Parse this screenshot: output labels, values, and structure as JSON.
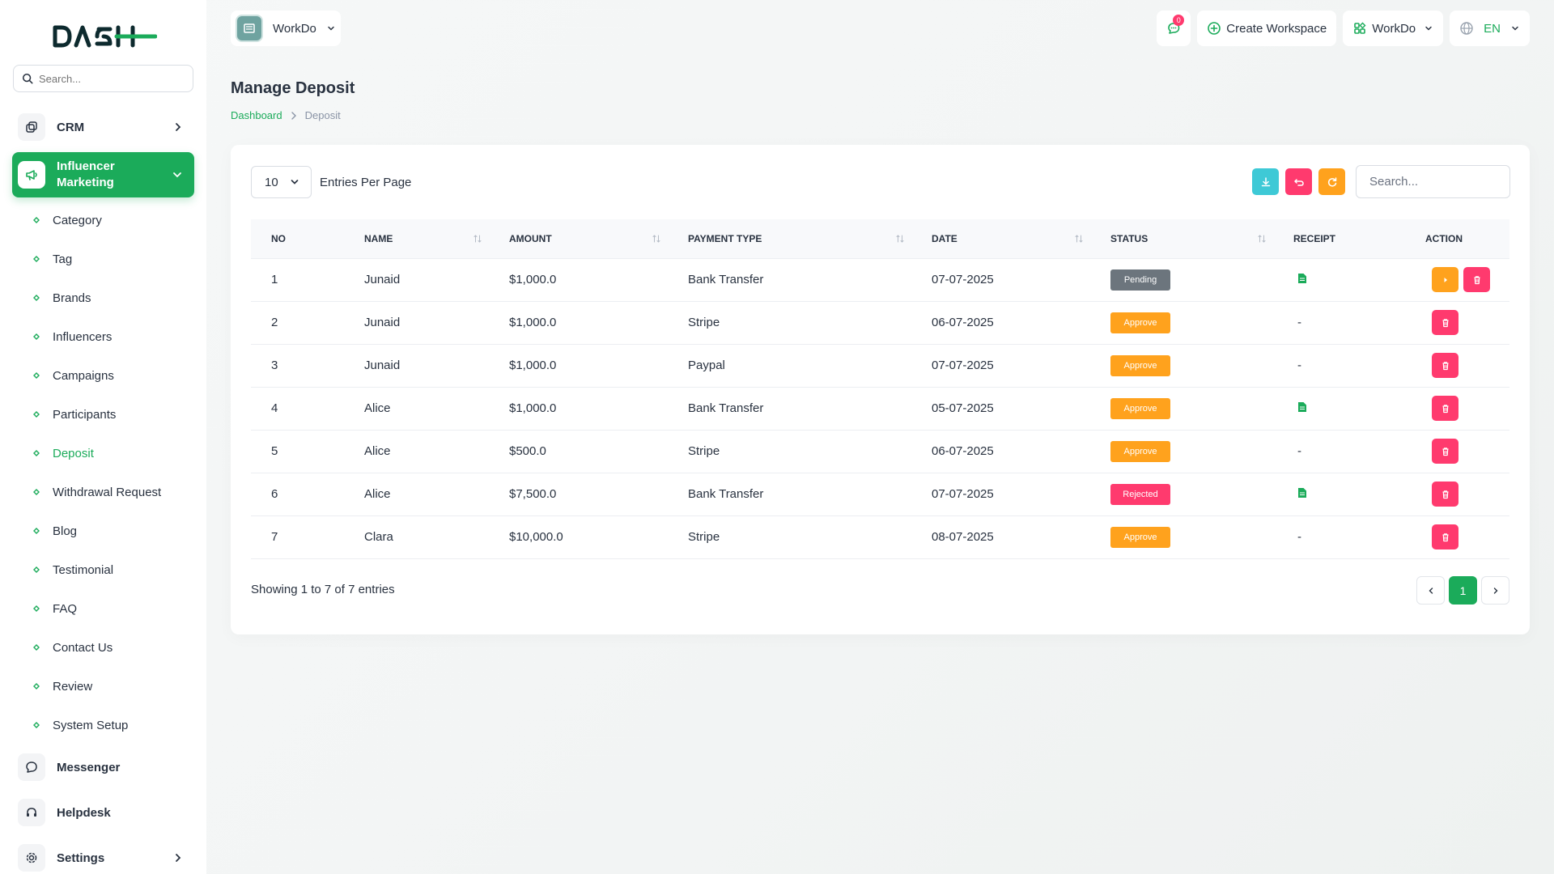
{
  "sidebar": {
    "search_placeholder": "Search...",
    "crm_label": "CRM",
    "active_group_label": "Influencer Marketing",
    "sub_items": [
      "Category",
      "Tag",
      "Brands",
      "Influencers",
      "Campaigns",
      "Participants",
      "Deposit",
      "Withdrawal Request",
      "Blog",
      "Testimonial",
      "FAQ",
      "Contact Us",
      "Review",
      "System Setup"
    ],
    "active_sub_item": "Deposit",
    "messenger_label": "Messenger",
    "helpdesk_label": "Helpdesk",
    "settings_label": "Settings"
  },
  "topbar": {
    "workspace_label": "WorkDo",
    "notification_count": "0",
    "create_workspace_label": "Create Workspace",
    "workspace_menu_label": "WorkDo",
    "language_label": "EN"
  },
  "header": {
    "title": "Manage Deposit",
    "breadcrumb_home": "Dashboard",
    "breadcrumb_current": "Deposit"
  },
  "table_controls": {
    "entries_value": "10",
    "entries_label": "Entries Per Page",
    "search_placeholder": "Search..."
  },
  "table": {
    "columns": [
      "NO",
      "NAME",
      "AMOUNT",
      "PAYMENT TYPE",
      "DATE",
      "STATUS",
      "RECEIPT",
      "ACTION"
    ],
    "rows": [
      {
        "no": "1",
        "name": "Junaid",
        "amount": "$1,000.0",
        "payment_type": "Bank Transfer",
        "date": "07-07-2025",
        "status": "Pending",
        "receipt": "file-icon",
        "actions": [
          "approve",
          "delete"
        ]
      },
      {
        "no": "2",
        "name": "Junaid",
        "amount": "$1,000.0",
        "payment_type": "Stripe",
        "date": "06-07-2025",
        "status": "Approve",
        "receipt": "-",
        "actions": [
          "delete"
        ]
      },
      {
        "no": "3",
        "name": "Junaid",
        "amount": "$1,000.0",
        "payment_type": "Paypal",
        "date": "07-07-2025",
        "status": "Approve",
        "receipt": "-",
        "actions": [
          "delete"
        ]
      },
      {
        "no": "4",
        "name": "Alice",
        "amount": "$1,000.0",
        "payment_type": "Bank Transfer",
        "date": "05-07-2025",
        "status": "Approve",
        "receipt": "file-icon",
        "actions": [
          "delete"
        ]
      },
      {
        "no": "5",
        "name": "Alice",
        "amount": "$500.0",
        "payment_type": "Stripe",
        "date": "06-07-2025",
        "status": "Approve",
        "receipt": "-",
        "actions": [
          "delete"
        ]
      },
      {
        "no": "6",
        "name": "Alice",
        "amount": "$7,500.0",
        "payment_type": "Bank Transfer",
        "date": "07-07-2025",
        "status": "Rejected",
        "receipt": "file-icon",
        "actions": [
          "delete"
        ]
      },
      {
        "no": "7",
        "name": "Clara",
        "amount": "$10,000.0",
        "payment_type": "Stripe",
        "date": "08-07-2025",
        "status": "Approve",
        "receipt": "-",
        "actions": [
          "delete"
        ]
      }
    ]
  },
  "footer": {
    "showing_text": "Showing 1 to 7 of 7 entries",
    "current_page": "1"
  },
  "colors": {
    "primary": "#1bab5a",
    "pending": "#6c757d",
    "approve": "#ffa21d",
    "rejected": "#ff3a6e",
    "info": "#3ec9d6"
  }
}
